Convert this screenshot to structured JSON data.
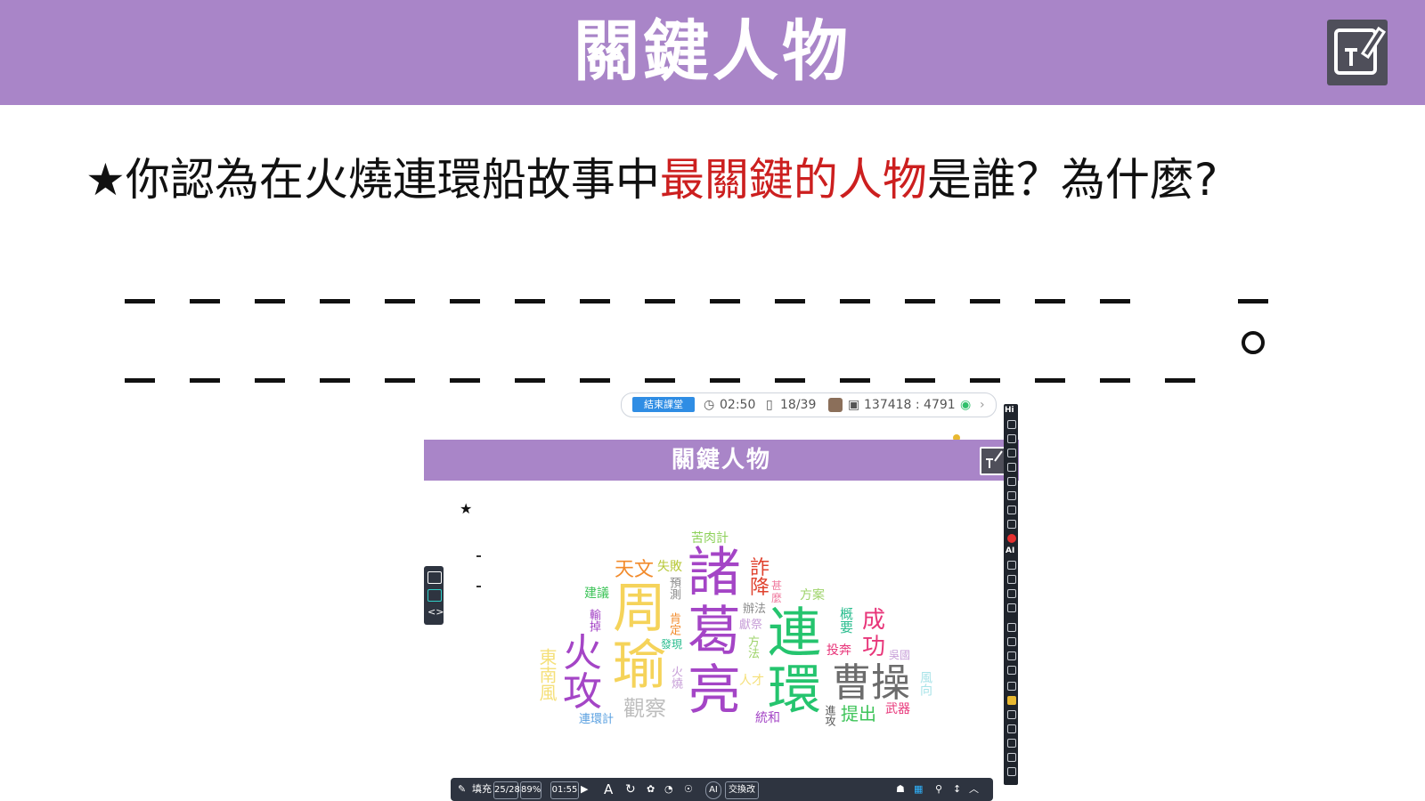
{
  "slide": {
    "title": "關鍵人物",
    "question_prefix": "★你認為在火燒連環船故事中",
    "question_highlight": "最關鍵的人物",
    "question_suffix": "是誰？為什麼?",
    "end_mark": "。"
  },
  "app_toolbar": {
    "end_class_label": "結束課堂",
    "timer": "02:50",
    "page": "18/39",
    "class_code": "137418 : 4791"
  },
  "preview": {
    "title": "關鍵人物",
    "star": "★"
  },
  "bottom_bar": {
    "fill_label": "填充",
    "answered": "25/28",
    "percent": "89%",
    "time": "01:55",
    "swap_label": "交換改",
    "ai_label": "AI"
  },
  "side_tools": {
    "hi_label": "Hi",
    "ai_label": "AI"
  },
  "word_cloud": {
    "words": [
      {
        "text": "苦肉計",
        "color": "#8dd15a"
      },
      {
        "text": "天文",
        "color": "#f28b2c"
      },
      {
        "text": "失敗",
        "color": "#b8c93a"
      },
      {
        "text": "諸",
        "color": "#a445c6"
      },
      {
        "text": "詐",
        "color": "#e0432f"
      },
      {
        "text": "降",
        "color": "#e0432f"
      },
      {
        "text": "甚",
        "color": "#f07ca0"
      },
      {
        "text": "麼",
        "color": "#f07ca0"
      },
      {
        "text": "方案",
        "color": "#9ed36a"
      },
      {
        "text": "建議",
        "color": "#3fc45a"
      },
      {
        "text": "周",
        "color": "#f5d35a"
      },
      {
        "text": "預測",
        "color": "#8a8a8a"
      },
      {
        "text": "葛",
        "color": "#a445c6"
      },
      {
        "text": "辦法",
        "color": "#8a8a8a"
      },
      {
        "text": "連",
        "color": "#25c46e"
      },
      {
        "text": "成",
        "color": "#e8367a"
      },
      {
        "text": "功",
        "color": "#e8367a"
      },
      {
        "text": "概要",
        "color": "#2bbd8f"
      },
      {
        "text": "輸掉",
        "color": "#a445c6"
      },
      {
        "text": "肯定",
        "color": "#f28b2c"
      },
      {
        "text": "獻祭",
        "color": "#c8a0d8"
      },
      {
        "text": "瑜",
        "color": "#f5d35a"
      },
      {
        "text": "方法",
        "color": "#9ed36a"
      },
      {
        "text": "投奔",
        "color": "#e8367a"
      },
      {
        "text": "吳國",
        "color": "#c8a0d8"
      },
      {
        "text": "火",
        "color": "#a445c6"
      },
      {
        "text": "攻",
        "color": "#a445c6"
      },
      {
        "text": "發現",
        "color": "#2bbd8f"
      },
      {
        "text": "東南風",
        "color": "#f5e07a"
      },
      {
        "text": "亮",
        "color": "#a445c6"
      },
      {
        "text": "環",
        "color": "#25c46e"
      },
      {
        "text": "曹操",
        "color": "#6c6c6c"
      },
      {
        "text": "火燒",
        "color": "#c8a0d8"
      },
      {
        "text": "人才",
        "color": "#f5e07a"
      },
      {
        "text": "風向",
        "color": "#a8e3e8"
      },
      {
        "text": "觀察",
        "color": "#bdbdbd"
      },
      {
        "text": "提出",
        "color": "#3fc45a"
      },
      {
        "text": "武器",
        "color": "#e8367a"
      },
      {
        "text": "進攻",
        "color": "#555555"
      },
      {
        "text": "連環計",
        "color": "#5aa0e0"
      },
      {
        "text": "統和",
        "color": "#a445c6"
      }
    ]
  }
}
